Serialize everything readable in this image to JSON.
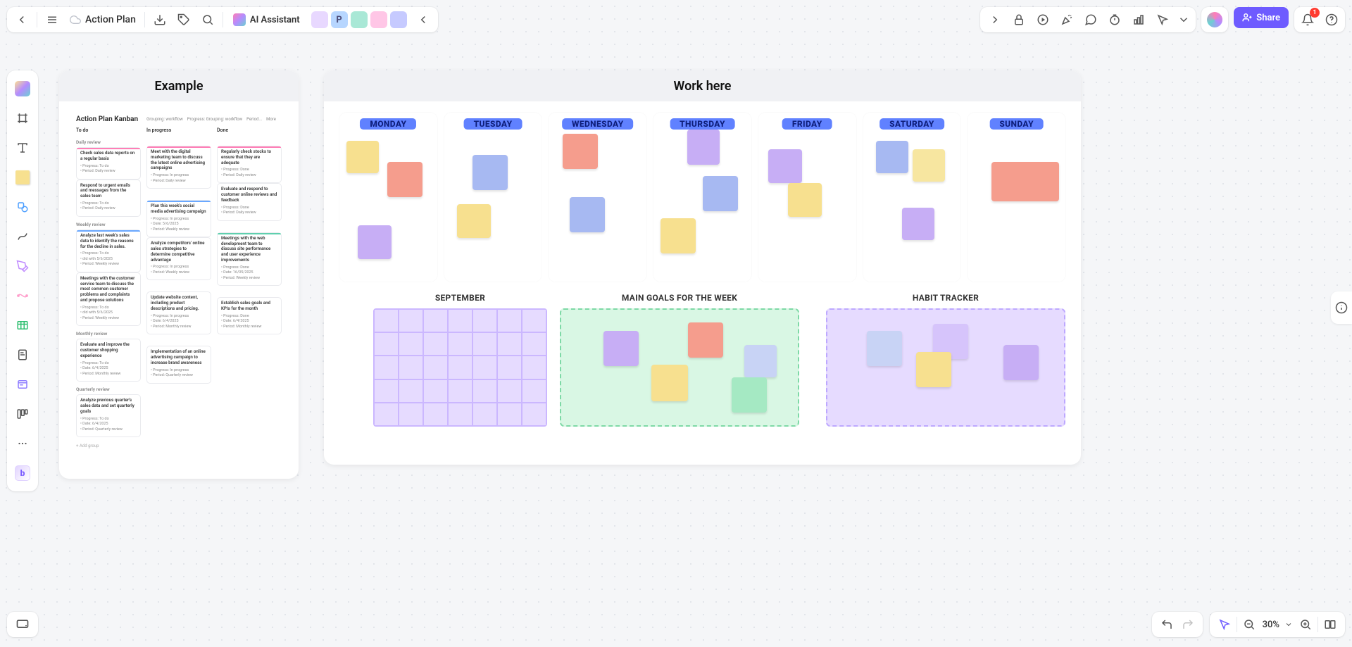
{
  "header": {
    "doc_title": "Action Plan",
    "ai_label": "AI Assistant",
    "share_label": "Share",
    "notif_count": "1",
    "collabs": [
      {
        "initial": "",
        "bg": "#e8d8ff"
      },
      {
        "initial": "P",
        "bg": "#b7d6ff"
      },
      {
        "initial": "",
        "bg": "#a9e8d6"
      },
      {
        "initial": "",
        "bg": "#ffc6e6"
      },
      {
        "initial": "",
        "bg": "#c6caff"
      }
    ]
  },
  "zoom": {
    "level": "30%"
  },
  "frames": {
    "example": {
      "title": "Example"
    },
    "work_here": {
      "title": "Work here"
    }
  },
  "kanban": {
    "title": "Action Plan Kanban",
    "toolbar": [
      "Grouping: workflow",
      "Progress: Grouping: workflow",
      "Period...",
      "More"
    ],
    "columns": [
      "To do",
      "In progress",
      "Done"
    ],
    "sections": [
      "Daily review",
      "Weekly review",
      "Monthly review",
      "Quarterly review"
    ],
    "cards": {
      "todo": {
        "daily": [
          {
            "t": "Check sales data reports on a regular basis",
            "m": [
              "Progress: To do",
              "Period: Daily review"
            ],
            "bar": "pink"
          },
          {
            "t": "Respond to urgent emails and messages from the sales team",
            "m": [
              "Progress: To do",
              "Period: Daily review"
            ]
          }
        ],
        "weekly": [
          {
            "t": "Analyze last week's sales data to identify the reasons for the decline in sales.",
            "m": [
              "Progress: To do",
              "did with 5/6/2025",
              "Period: Weekly review"
            ],
            "bar": "blue"
          },
          {
            "t": "Meetings with the customer service team to discuss the most common customer problems and complaints and propose solutions",
            "m": [
              "Progress: To do",
              "did with 5/6/2025",
              "Period: Weekly review"
            ]
          }
        ],
        "monthly": [
          {
            "t": "Evaluate and improve the customer shopping experience",
            "m": [
              "Progress: To do",
              "Date: 6/4/2025",
              "Period: Monthly review"
            ]
          }
        ],
        "quarterly": [
          {
            "t": "Analyze previous quarter's sales data and set quarterly goals",
            "m": [
              "Progress: To do",
              "Date: 6/4/2025",
              "Period: Quarterly review"
            ]
          }
        ]
      },
      "inprogress": {
        "daily": [
          {
            "t": "Meet with the digital marketing team to discuss the latest online advertising campaigns",
            "m": [
              "Progress: In progress",
              "Period: Daily review"
            ],
            "bar": "pink"
          }
        ],
        "weekly": [
          {
            "t": "Plan this week's social media advertising campaign",
            "m": [
              "Progress: In progress",
              "Date: 5/6/2025",
              "Period: Weekly review"
            ],
            "bar": "blue"
          },
          {
            "t": "Analyze competitors' online sales strategies to determine competitive advantage",
            "m": [
              "Progress: In progress",
              "Period: Weekly review"
            ]
          }
        ],
        "monthly": [
          {
            "t": "Update website content, including product descriptions and pricing.",
            "m": [
              "Progress: In progress",
              "Date: 6/4/2025",
              "Period: Monthly review"
            ]
          }
        ],
        "quarterly": [
          {
            "t": "Implementation of an online advertising campaign to increase brand awareness",
            "m": [
              "Progress: In progress",
              "Period: Quarterly review"
            ]
          }
        ]
      },
      "done": {
        "daily": [
          {
            "t": "Regularly check stocks to ensure that they are adequate",
            "m": [
              "Progress: Done",
              "Period: Daily review"
            ],
            "bar": "pink"
          },
          {
            "t": "Evaluate and respond to customer online reviews and feedback",
            "m": [
              "Progress: Done",
              "Period: Daily review"
            ]
          }
        ],
        "weekly": [
          {
            "t": "Meetings with the web development team to discuss site performance and user experience improvements",
            "m": [
              "Progress: Done",
              "Date: 16/05/2025",
              "Period: Weekly review"
            ],
            "bar": "teal"
          }
        ],
        "monthly": [
          {
            "t": "Establish sales goals and KPIs for the month",
            "m": [
              "Progress: Done",
              "Date: 6/4/2025",
              "Period: Monthly review"
            ]
          }
        ]
      }
    },
    "add_group": "+ Add group"
  },
  "week": {
    "days": [
      "MONDAY",
      "TUESDAY",
      "WEDNESDAY",
      "THURSDAY",
      "FRIDAY",
      "SATURDAY",
      "SUNDAY"
    ]
  },
  "lower": {
    "cal_title": "SEPTEMBER",
    "goals_title": "MAIN GOALS FOR THE WEEK",
    "habit_title": "HABIT TRACKER"
  }
}
